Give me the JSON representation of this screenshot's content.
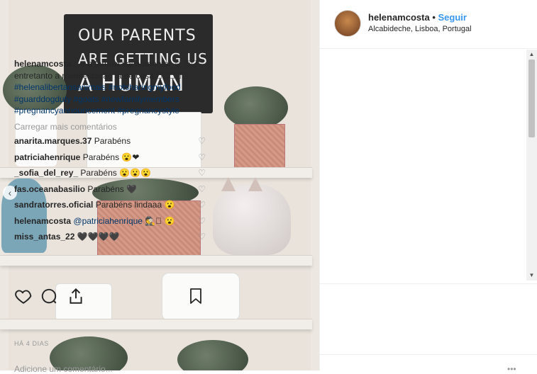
{
  "post": {
    "username": "helenamcosta",
    "separator": "•",
    "follow_label": "Seguir",
    "location": "Alcabideche, Lisboa, Portugal",
    "caption_user": "helenamcosta",
    "caption_text": "...e a família vai aumentar ☺ 󾓦󾓦 entretanto a manifestação lá de casa 󾓦󾓦󾓦󾓦󾓦",
    "hashtags": [
      "#helenalibertaosanimais",
      "#notsharingmyfood",
      "#guarddogduty",
      "#goats",
      "#newfamilymembers",
      "#pregnancyannouncement",
      "#pregnancystyle"
    ],
    "load_more": "Carregar mais comentários",
    "comments": [
      {
        "user": "anarita.marques.37",
        "text": "Parabéns"
      },
      {
        "user": "patriciahenrique",
        "text": "Parabéns 😮❤"
      },
      {
        "user": "_sofia_del_rey_",
        "text": "Parabéns 😮😮😮"
      },
      {
        "user": "fas.oceanabasilio",
        "text": "Parabéns 🖤"
      },
      {
        "user": "sandratorres.oficial",
        "text": "Parabéns lindaaa 😮"
      },
      {
        "user": "helenamcosta",
        "mention": "@patriciahenrique",
        "text": "🕵󾓦 😮"
      },
      {
        "user": "miss_antas_22",
        "text": "🖤🖤🖤🖤"
      }
    ],
    "time": "HÁ 4 DIAS",
    "add_comment_placeholder": "Adicione um comentário...",
    "more_icon": "•••"
  },
  "photo": {
    "chalkboard_lines": [
      "OUR PARENTS",
      "ARE GETTING US",
      "A HUMAN"
    ],
    "nav_prev": "‹"
  },
  "icons": {
    "heart": "heart-icon",
    "comment": "comment-icon",
    "share": "share-icon",
    "bookmark": "bookmark-icon"
  },
  "colors": {
    "link": "#3897f0",
    "hashtag": "#003569",
    "muted": "#999999"
  }
}
